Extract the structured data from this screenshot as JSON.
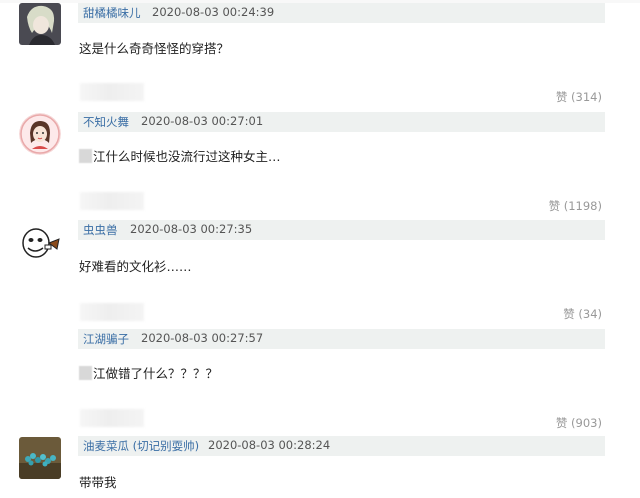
{
  "comments": [
    {
      "username": "甜橘橘味儿",
      "timestamp": "2020-08-03 00:24:39",
      "text": "这是什么奇奇怪怪的穿搭？",
      "likes": "赞 (314)"
    },
    {
      "username": "不知火舞",
      "timestamp": "2020-08-03 00:27:01",
      "text": "江什么时候也没流行过这种女主…",
      "likes": "赞 (1198)"
    },
    {
      "username": "虫虫兽",
      "timestamp": "2020-08-03 00:27:35",
      "text": "好难看的文化衫……",
      "likes": "赞 (34)"
    },
    {
      "username": "江湖骗子",
      "timestamp": "2020-08-03 00:27:57",
      "text": "江做错了什么？？？？",
      "likes": "赞 (903)"
    },
    {
      "username": "油麦菜瓜 (切记别耍帅)",
      "timestamp": "2020-08-03 00:28:24",
      "text": "带带我",
      "likes": ""
    }
  ]
}
